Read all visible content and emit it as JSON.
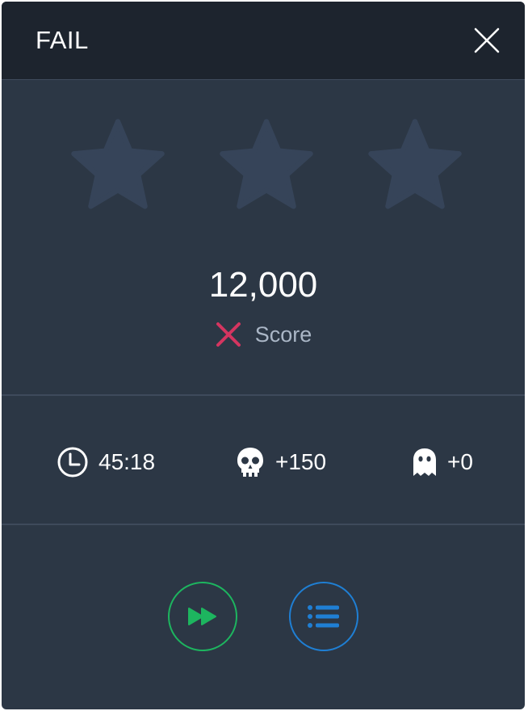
{
  "dialog": {
    "title": "FAIL",
    "close_icon": "close-icon"
  },
  "stars": {
    "earned": 0,
    "total": 3,
    "icon": "star-icon",
    "empty_color": "#364459"
  },
  "score": {
    "value": "12,000",
    "label": "Score",
    "status_icon": "fail-x-icon",
    "status_color": "#d43560"
  },
  "stats": {
    "time": {
      "icon": "clock-icon",
      "value": "45:18"
    },
    "kills": {
      "icon": "skull-icon",
      "value": "+150"
    },
    "ghosts": {
      "icon": "ghost-icon",
      "value": "+0"
    }
  },
  "actions": {
    "skip": {
      "icon": "fast-forward-icon",
      "color": "#1db55f"
    },
    "menu": {
      "icon": "list-icon",
      "color": "#1f7fd4"
    }
  },
  "colors": {
    "panel": "#2c3745",
    "header": "#1d242e",
    "divider": "#3e4a5b"
  }
}
